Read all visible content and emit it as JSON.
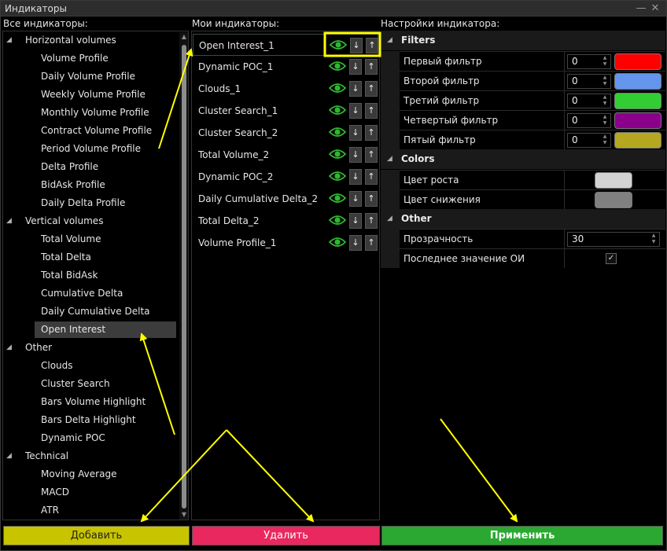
{
  "window": {
    "title": "Индикаторы",
    "minimize_glyph": "—",
    "close_glyph": "✕"
  },
  "headers": {
    "all": "Все индикаторы:",
    "mine": "Мои индикаторы:",
    "settings": "Настройки индикатора:"
  },
  "tree": [
    {
      "group": "Horizontal volumes",
      "items": [
        "Volume Profile",
        "Daily Volume Profile",
        "Weekly Volume Profile",
        "Monthly Volume Profile",
        "Contract Volume Profile",
        "Period Volume Profile",
        "Delta Profile",
        "BidAsk Profile",
        "Daily Delta Profile"
      ]
    },
    {
      "group": "Vertical volumes",
      "items": [
        "Total Volume",
        "Total Delta",
        "Total BidAsk",
        "Cumulative Delta",
        "Daily Cumulative Delta",
        "Open Interest"
      ]
    },
    {
      "group": "Other",
      "items": [
        "Clouds",
        "Cluster Search",
        "Bars Volume Highlight",
        "Bars Delta Highlight",
        "Dynamic POC"
      ]
    },
    {
      "group": "Technical",
      "items": [
        "Moving Average",
        "MACD",
        "ATR"
      ]
    }
  ],
  "selected_tree_item": "Open Interest",
  "my_indicators": [
    "Open Interest_1",
    "Dynamic POC_1",
    "Clouds_1",
    "Cluster Search_1",
    "Cluster Search_2",
    "Total Volume_2",
    "Dynamic POC_2",
    "Daily Cumulative Delta_2",
    "Total Delta_2",
    "Volume Profile_1"
  ],
  "row_buttons": {
    "down": "↓",
    "up": "↑",
    "eye_icon": "eye-icon"
  },
  "settings": {
    "filters": {
      "title": "Filters",
      "rows": [
        {
          "label": "Первый фильтр",
          "value": "0",
          "color": "#ff0000"
        },
        {
          "label": "Второй фильтр",
          "value": "0",
          "color": "#6495ed"
        },
        {
          "label": "Третий фильтр",
          "value": "0",
          "color": "#32cd32"
        },
        {
          "label": "Четвертый фильтр",
          "value": "0",
          "color": "#8b008b"
        },
        {
          "label": "Пятый фильтр",
          "value": "0",
          "color": "#b5a820"
        }
      ]
    },
    "colors": {
      "title": "Colors",
      "rows": [
        {
          "label": "Цвет роста",
          "color": "#d3d3d3"
        },
        {
          "label": "Цвет снижения",
          "color": "#808080"
        }
      ]
    },
    "other": {
      "title": "Other",
      "transparency_label": "Прозрачность",
      "transparency_value": "30",
      "last_oi_label": "Последнее значение ОИ",
      "last_oi_checked": "✓"
    }
  },
  "buttons": {
    "add": "Добавить",
    "delete": "Удалить",
    "apply": "Применить"
  },
  "colors": {
    "add": "#c8c400",
    "delete": "#e8285e",
    "apply": "#2aa831",
    "eye": "#2fb52f",
    "annotation": "#ffff00"
  }
}
